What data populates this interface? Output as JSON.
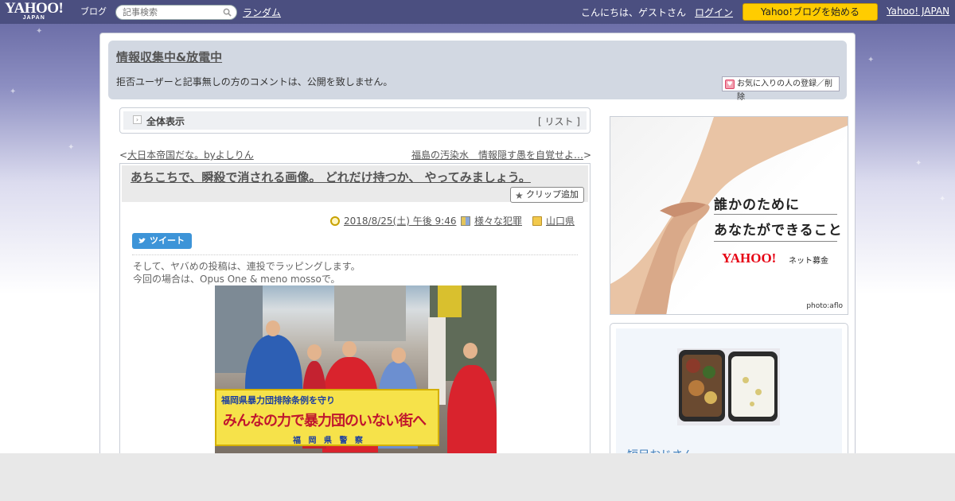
{
  "topbar": {
    "logo_main": "YAHOO!",
    "logo_sub_jp": "JAPAN",
    "logo_blog": "ブログ",
    "search_placeholder": "記事検索",
    "random_link": "ランダム",
    "greeting": "こんにちは、ゲストさん",
    "login_link": "ログイン",
    "start_blog_button": "Yahoo!ブログを始める",
    "yahoo_japan_link": "Yahoo! JAPAN"
  },
  "blog_header": {
    "title": "情報収集中&放電中",
    "description": "拒否ユーザーと記事無しの方のコメントは、公開を致しません。",
    "favorite_button": "お気に入りの人の登録／削除"
  },
  "breadcrumb": {
    "label": "全体表示",
    "list_link": "[ リスト ]"
  },
  "pager": {
    "prev": "< 大日本帝国だな。byよしりん",
    "prev_arrow": "<",
    "prev_title": "大日本帝国だな。byよしりん",
    "next_title": "福島の汚染水　情報隠す愚を自覚せよ…",
    "next_arrow": ">"
  },
  "article": {
    "title": "あちこちで、瞬殺で消される画像。 どれだけ持つか、 やってみましょう。",
    "clip_button": "クリップ追加",
    "date": "2018/8/25(土) 午後 9:46",
    "category": "様々な犯罪",
    "folder": "山口県",
    "tweet_button": "ツイート",
    "body_line1": "そして、ヤバめの投稿は、連投でラッピングします。",
    "body_line2": "今回の場合は、Opus One & meno mossoで。",
    "photo_banner_line1": "福岡県暴力団排除条例を守り",
    "photo_banner_line2": "みんなの力で暴力団のいない街へ",
    "photo_banner_line3": "福 岡 県 警 察"
  },
  "ad": {
    "line1": "誰かのために",
    "line2": "あなたができること",
    "brand": "YAHOO!",
    "brand_sub": "ネット募金",
    "credit": "photo:aflo"
  },
  "profile": {
    "name": "短足おじさん"
  },
  "colors": {
    "topbar": "#4b4f80",
    "header_panel": "#d2d8e2",
    "start_button": "#ffcc00",
    "tweet_button": "#3d94d8"
  }
}
